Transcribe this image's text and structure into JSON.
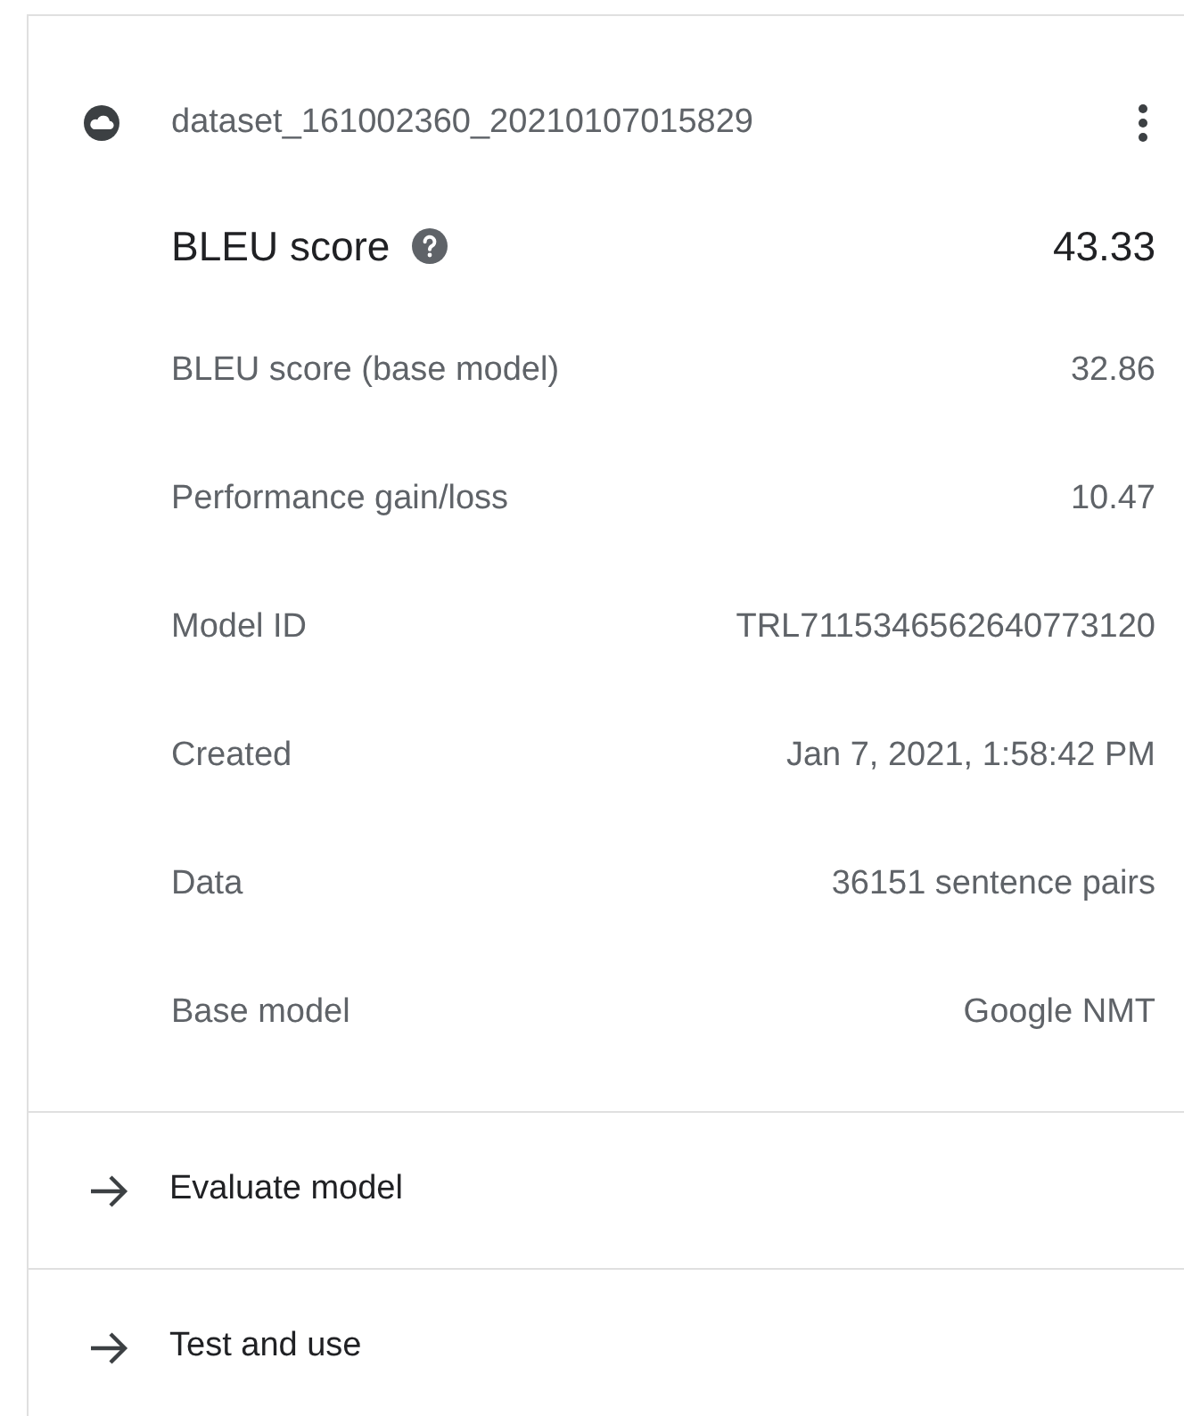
{
  "card": {
    "title": "dataset_161002360_20210107015829",
    "metrics": [
      {
        "kind": "primary",
        "label": "BLEU score",
        "value": "43.33",
        "help": true
      },
      {
        "kind": "detail",
        "label": "BLEU score (base model)",
        "value": "32.86"
      },
      {
        "kind": "detail",
        "label": "Performance gain/loss",
        "value": "10.47"
      },
      {
        "kind": "detail",
        "label": "Model ID",
        "value": "TRL7115346562640773120"
      },
      {
        "kind": "detail",
        "label": "Created",
        "value": "Jan 7, 2021, 1:58:42 PM"
      },
      {
        "kind": "detail",
        "label": "Data",
        "value": "36151 sentence pairs"
      },
      {
        "kind": "detail",
        "label": "Base model",
        "value": "Google NMT"
      }
    ],
    "actions": [
      "Evaluate model",
      "Test and use"
    ]
  }
}
